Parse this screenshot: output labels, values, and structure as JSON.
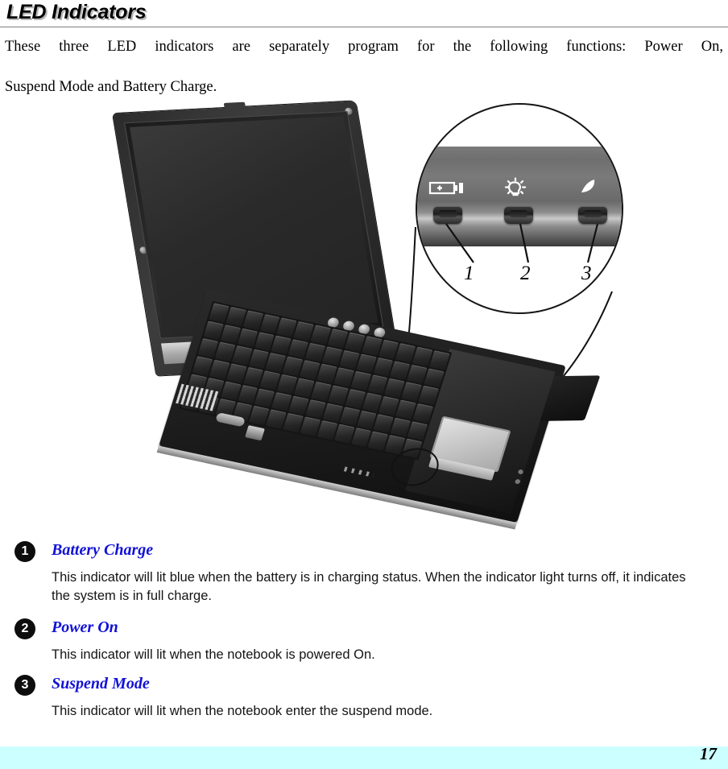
{
  "document": {
    "heading": "LED Indicators",
    "intro_line1": "These three LED indicators are separately program for the following functions: Power On,",
    "intro_line2": "Suspend Mode and Battery Charge.",
    "page_number": "17",
    "footer_band_color": "#ccffff",
    "accent_color": "#1212d6"
  },
  "figure": {
    "caption_numbers": [
      "1",
      "2",
      "3"
    ],
    "callout": {
      "leds": [
        {
          "number": "1",
          "icon": "battery-icon",
          "label": "Battery Charge"
        },
        {
          "number": "2",
          "icon": "lightbulb-icon",
          "label": "Power On"
        },
        {
          "number": "3",
          "icon": "crescent-moon-icon",
          "label": "Suspend Mode"
        }
      ]
    },
    "device": "notebook-computer-photo"
  },
  "items": [
    {
      "number": "1",
      "title": "Battery Charge",
      "body": "This indicator will lit blue when the battery is in charging status.  When the indicator light turns off, it indicates the system is in full charge."
    },
    {
      "number": "2",
      "title": "Power On",
      "body": "This indicator will lit when the notebook is powered On."
    },
    {
      "number": "3",
      "title": "Suspend Mode",
      "body": "This indicator will lit when the notebook enter the suspend mode."
    }
  ]
}
